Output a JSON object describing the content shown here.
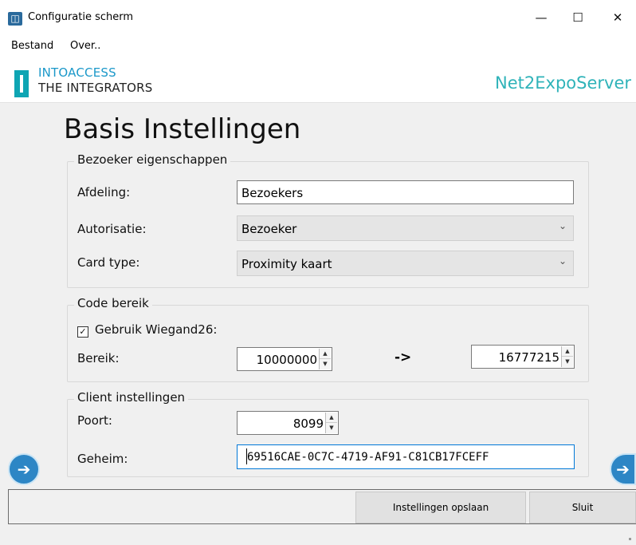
{
  "window": {
    "title": "Configuratie scherm",
    "minimize": "—",
    "maximize": "☐",
    "close": "✕"
  },
  "menu": {
    "items": [
      "Bestand",
      "Over.."
    ]
  },
  "brand": {
    "line1": "INTOACCESS",
    "line2": "THE INTEGRATORS",
    "product": "Net2ExpoServer"
  },
  "page": {
    "heading": "Basis Instellingen"
  },
  "visitor": {
    "legend": "Bezoeker eigenschappen",
    "department_label": "Afdeling:",
    "department_value": "Bezoekers",
    "authorization_label": "Autorisatie:",
    "authorization_value": "Bezoeker",
    "cardtype_label": "Card type:",
    "cardtype_value": "Proximity kaart"
  },
  "code": {
    "legend": "Code bereik",
    "wiegand_label": "Gebruik Wiegand26:",
    "wiegand_checked": true,
    "range_label": "Bereik:",
    "range_from": "10000000",
    "range_arrow": "->",
    "range_to": "16777215"
  },
  "client": {
    "legend": "Client instellingen",
    "port_label": "Poort:",
    "port_value": "8099",
    "secret_label": "Geheim:",
    "secret_value": "69516CAE-0C7C-4719-AF91-C81CB17FCEFF"
  },
  "footer": {
    "save_label": "Instellingen opslaan",
    "close_label": "Sluit"
  },
  "icons": {
    "app": "building-icon",
    "prev": "arrow-left-icon",
    "next": "arrow-right-icon",
    "check": "✓",
    "chevron": "⌄",
    "spin_up": "▲",
    "spin_down": "▼"
  },
  "colors": {
    "brand_teal": "#0ea5b3",
    "brand_blue": "#1b98c9",
    "product": "#2fb3b9",
    "focus": "#0078d7",
    "nav_button": "#2d86c5"
  }
}
